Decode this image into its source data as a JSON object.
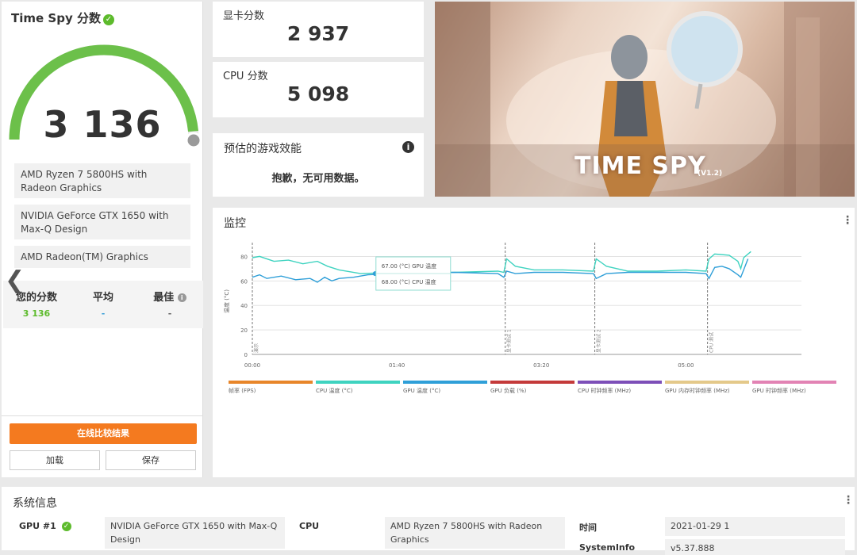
{
  "score_panel": {
    "title": "Time Spy 分数",
    "score": "3 136",
    "hardware": [
      "AMD Ryzen 7 5800HS with Radeon Graphics",
      "NVIDIA GeForce GTX 1650 with Max-Q Design",
      "AMD Radeon(TM) Graphics"
    ],
    "stats": {
      "yours_label": "您的分数",
      "yours_value": "3 136",
      "avg_label": "平均",
      "avg_value": "-",
      "best_label": "最佳",
      "best_value": "-"
    },
    "compare_button": "在线比较结果",
    "load_button": "加载",
    "save_button": "保存",
    "gauge_fraction": 0.97,
    "colors": {
      "gauge": "#6cc04a",
      "score_green": "#5dbb2c",
      "avg_blue": "#3da0d8",
      "button": "#f47a1f"
    }
  },
  "gpu_score": {
    "label": "显卡分数",
    "value": "2 937"
  },
  "cpu_score": {
    "label": "CPU 分数",
    "value": "5 098"
  },
  "estimate": {
    "title": "预估的游戏效能",
    "message": "抱歉，无可用数据。"
  },
  "hero": {
    "title": "TIME SPY",
    "version": "(V1.2)"
  },
  "monitor": {
    "title": "监控",
    "tooltip": {
      "gpu": "67.00 (°C) GPU 温度",
      "cpu": "68.00 (°C) CPU 温度"
    },
    "legend": [
      {
        "label": "帧率 (FPS)",
        "color": "#e8862a"
      },
      {
        "label": "CPU 温度 (°C)",
        "color": "#3fd3c0"
      },
      {
        "label": "GPU 温度 (°C)",
        "color": "#2f9fd8"
      },
      {
        "label": "GPU 负载 (%)",
        "color": "#c43a3a"
      },
      {
        "label": "CPU 时钟频率 (MHz)",
        "color": "#7d4fb8"
      },
      {
        "label": "GPU 内存时钟频率 (MHz)",
        "color": "#e4c98a"
      },
      {
        "label": "GPU 时钟频率 (MHz)",
        "color": "#e283b4"
      }
    ]
  },
  "chart_data": {
    "type": "line",
    "ylabel": "温度 (°C)",
    "ylim": [
      0,
      90
    ],
    "yticks": [
      0,
      20,
      40,
      60,
      80
    ],
    "xticks": [
      "00:00",
      "01:40",
      "03:20",
      "05:00"
    ],
    "xlim": [
      0,
      380
    ],
    "phase_markers": [
      {
        "x": 0,
        "label": "演示"
      },
      {
        "x": 175,
        "label": "显卡测试 1"
      },
      {
        "x": 237,
        "label": "显卡测试 2"
      },
      {
        "x": 315,
        "label": "CPU 测试"
      }
    ],
    "series": [
      {
        "name": "CPU 温度 (°C)",
        "color": "#3fd3c0",
        "x": [
          0,
          5,
          15,
          25,
          35,
          45,
          52,
          60,
          75,
          100,
          140,
          170,
          174,
          176,
          182,
          195,
          215,
          236,
          238,
          245,
          260,
          280,
          300,
          314,
          316,
          320,
          330,
          336,
          338,
          340,
          345
        ],
        "y": [
          79,
          80,
          76,
          77,
          74,
          76,
          72,
          69,
          66,
          67,
          67,
          68,
          67,
          78,
          72,
          69,
          69,
          68,
          78,
          72,
          68,
          68,
          69,
          68,
          78,
          82,
          81,
          76,
          70,
          79,
          84
        ]
      },
      {
        "name": "GPU 温度 (°C)",
        "color": "#2f9fd8",
        "x": [
          0,
          5,
          10,
          20,
          30,
          40,
          45,
          50,
          55,
          60,
          70,
          80,
          100,
          140,
          170,
          174,
          176,
          182,
          195,
          215,
          236,
          238,
          245,
          260,
          280,
          300,
          314,
          316,
          320,
          325,
          330,
          336,
          338,
          340,
          343
        ],
        "y": [
          63,
          65,
          62,
          64,
          61,
          62,
          59,
          63,
          60,
          62,
          63,
          65,
          66,
          67,
          66,
          63,
          68,
          66,
          67,
          67,
          66,
          62,
          66,
          67,
          67,
          67,
          66,
          62,
          71,
          72,
          70,
          65,
          63,
          69,
          78
        ]
      }
    ]
  },
  "system_info": {
    "title": "系统信息",
    "gpu_label": "GPU #1",
    "gpu_value": "NVIDIA GeForce GTX 1650 with Max-Q Design",
    "cpu_label": "CPU",
    "cpu_value": "AMD Ryzen 7 5800HS with Radeon Graphics",
    "time_label": "时间",
    "time_value": "2021-01-29 1",
    "sysinfo_label": "SystemInfo",
    "sysinfo_value": "v5.37.888"
  }
}
